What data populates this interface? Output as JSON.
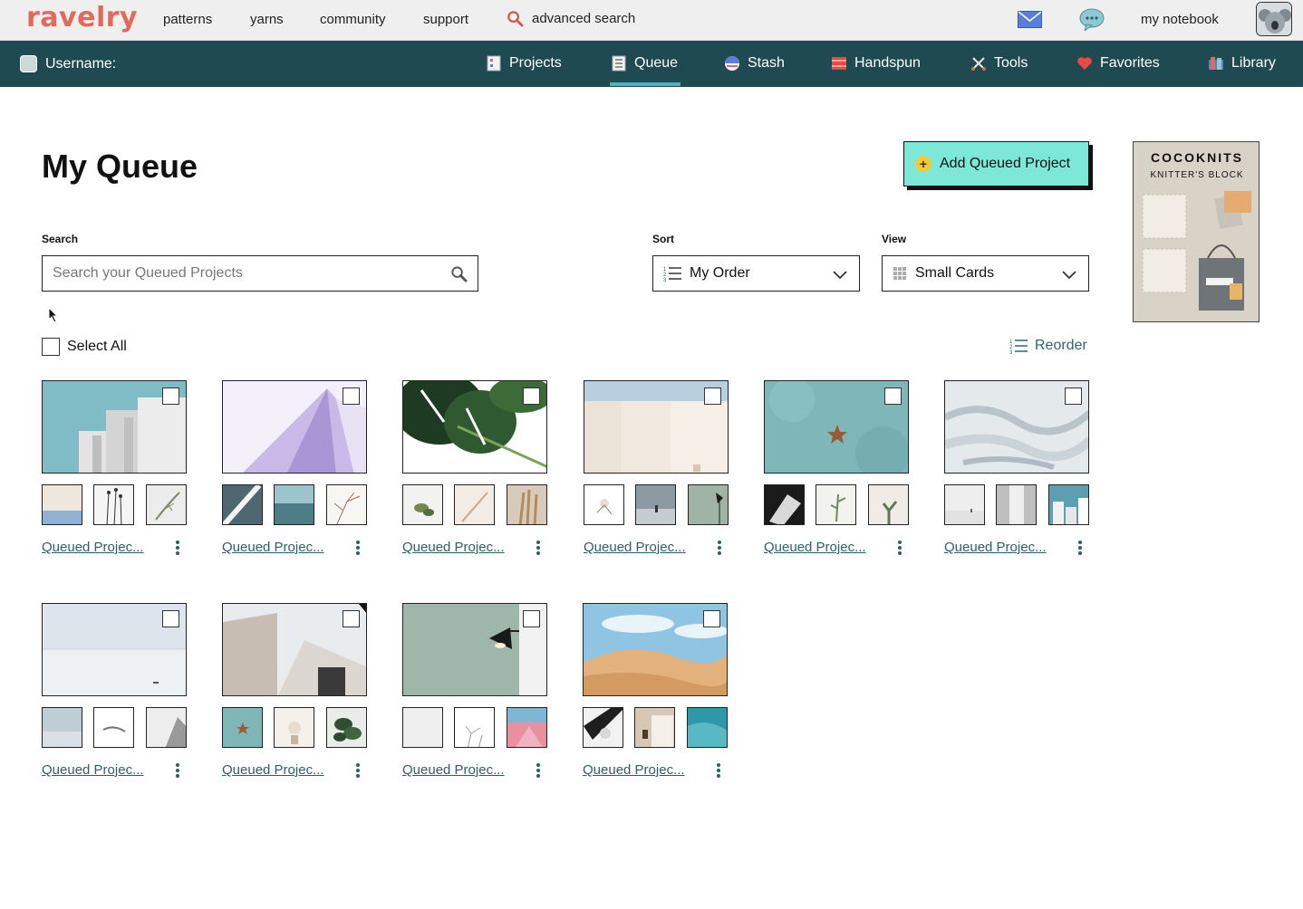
{
  "topbar": {
    "logo": "ravelry",
    "nav": [
      {
        "label": "patterns"
      },
      {
        "label": "yarns"
      },
      {
        "label": "community"
      },
      {
        "label": "support"
      }
    ],
    "advanced_search": "advanced search",
    "notebook": "my notebook"
  },
  "notebook_nav": {
    "username": "Username:",
    "items": [
      {
        "label": "Projects",
        "icon": "projects-icon"
      },
      {
        "label": "Queue",
        "icon": "queue-icon",
        "active": true
      },
      {
        "label": "Stash",
        "icon": "stash-icon"
      },
      {
        "label": "Handspun",
        "icon": "handspun-icon"
      },
      {
        "label": "Tools",
        "icon": "tools-icon"
      },
      {
        "label": "Favorites",
        "icon": "heart-icon"
      },
      {
        "label": "Library",
        "icon": "library-icon"
      }
    ],
    "active_color": "#49b3c2"
  },
  "main": {
    "title": "My Queue",
    "add_button": "Add Queued Project",
    "search_label": "Search",
    "search_placeholder": "Search your Queued Projects",
    "sort_label": "Sort",
    "sort_value": "My Order",
    "view_label": "View",
    "view_value": "Small Cards",
    "select_all": "Select All",
    "reorder": "Reorder"
  },
  "ad": {
    "title": "COCOKNITS",
    "subtitle": "KNITTER'S BLOCK"
  },
  "cards": [
    {
      "title": "Queued Projec..."
    },
    {
      "title": "Queued Projec..."
    },
    {
      "title": "Queued Projec..."
    },
    {
      "title": "Queued Projec..."
    },
    {
      "title": "Queued Projec..."
    },
    {
      "title": "Queued Projec..."
    },
    {
      "title": "Queued Projec..."
    },
    {
      "title": "Queued Projec..."
    },
    {
      "title": "Queued Projec..."
    },
    {
      "title": "Queued Projec..."
    }
  ],
  "colors": {
    "brand": "#e06a5c",
    "nav_bg": "#1f4a52",
    "button_bg": "#7ee8d8",
    "link": "#2d5f66"
  }
}
